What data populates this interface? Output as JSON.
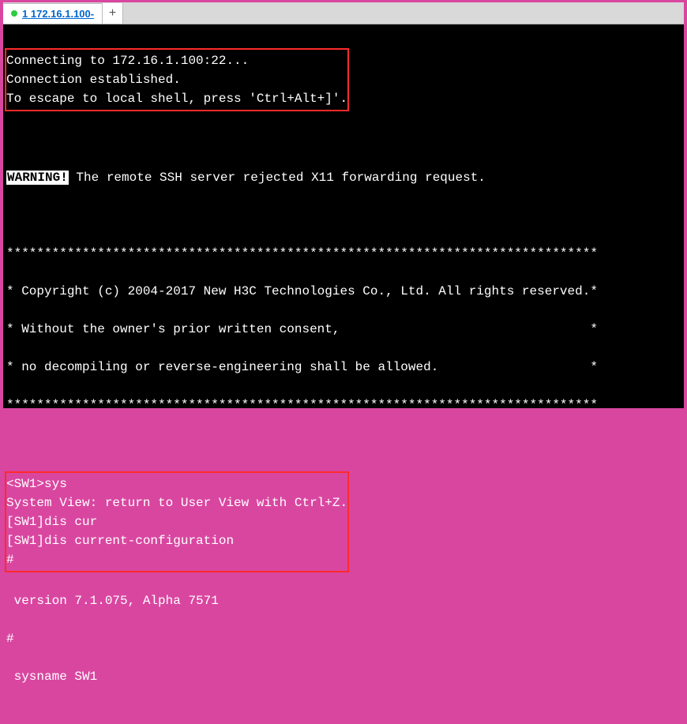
{
  "tab": {
    "index": "1",
    "title": "172.16.1.100-"
  },
  "terminal": {
    "connect_block": "Connecting to 172.16.1.100:22...\nConnection established.\nTo escape to local shell, press 'Ctrl+Alt+]'.",
    "warning_label": "WARNING!",
    "warning_text": " The remote SSH server rejected X11 forwarding request.",
    "banner_top": "******************************************************************************",
    "banner_line1": "* Copyright (c) 2004-2017 New H3C Technologies Co., Ltd. All rights reserved.*",
    "banner_line2": "* Without the owner's prior written consent,                                 *",
    "banner_line3": "* no decompiling or reverse-engineering shall be allowed.                    *",
    "banner_bottom": "******************************************************************************",
    "cmd_block": "<SW1>sys\nSystem View: return to User View with Ctrl+Z.\n[SW1]dis cur\n[SW1]dis current-configuration\n#",
    "tail_line1": " version 7.1.075, Alpha 7571",
    "tail_line2": "#",
    "tail_line3": " sysname SW1"
  }
}
